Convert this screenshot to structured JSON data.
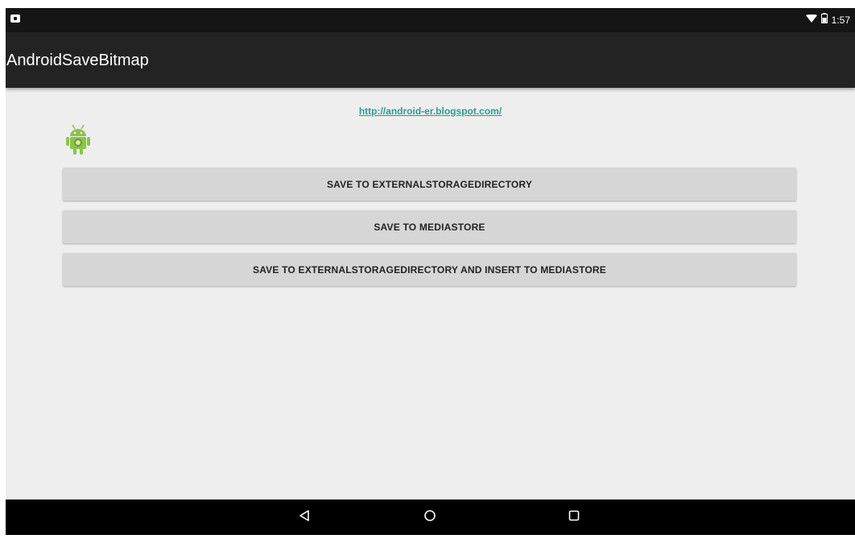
{
  "status_bar": {
    "time": "1:57",
    "icons": [
      "notification-icon",
      "wifi-icon",
      "battery-icon"
    ]
  },
  "app_bar": {
    "title": "AndroidSaveBitmap"
  },
  "content": {
    "link_text": "http://android-er.blogspot.com/",
    "image_icon": "android-icon",
    "buttons": [
      {
        "label": "SAVE TO EXTERNALSTORAGEDIRECTORY"
      },
      {
        "label": "SAVE TO MEDIASTORE"
      },
      {
        "label": "SAVE TO EXTERNALSTORAGEDIRECTORY AND INSERT TO MEDIASTORE"
      }
    ]
  },
  "nav_bar": {
    "icons": [
      "back-icon",
      "home-icon",
      "recents-icon"
    ]
  },
  "colors": {
    "app_bar": "#232323",
    "status_bar": "#151515",
    "background": "#eeeeee",
    "button": "#d6d6d6",
    "link": "#2a9c8c",
    "android_green": "#8bc34a"
  }
}
